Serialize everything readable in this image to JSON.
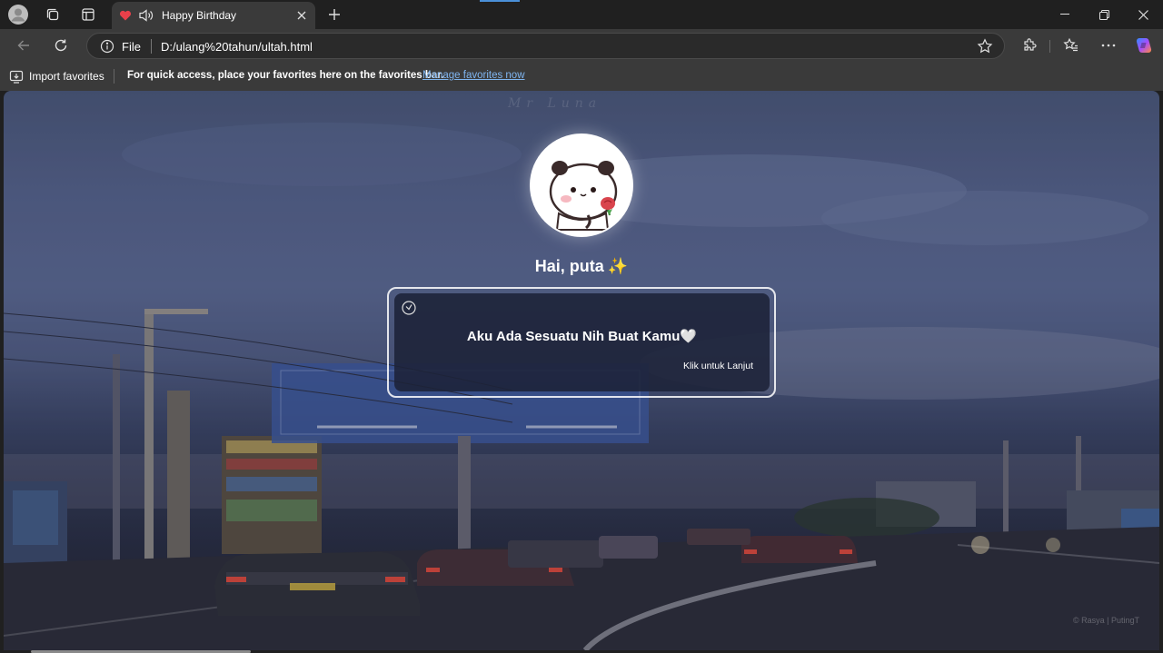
{
  "browser": {
    "tab": {
      "title": "Happy Birthday",
      "favicon": "heart-icon",
      "audio": "speaker-icon"
    },
    "address": {
      "scheme_label": "File",
      "url": "D:/ulang%20tahun/ultah.html"
    },
    "favorites_bar": {
      "import_label": "Import favorites",
      "message": "For quick access, place your favorites here on the favorites bar.",
      "manage_link": "Manage favorites now"
    }
  },
  "page": {
    "greeting": "Hai, puta",
    "greeting_emoji": "✨",
    "card": {
      "message": "Aku Ada Sesuatu Nih Buat Kamu🤍",
      "cta": "Klik untuk Lanjut"
    },
    "watermark": "© Rasya | PutingT",
    "top_script": "Mr Luna"
  },
  "colors": {
    "accent_link": "#7fb5f0",
    "tab_active": "#3a3a3a",
    "titlebar": "#202020"
  }
}
